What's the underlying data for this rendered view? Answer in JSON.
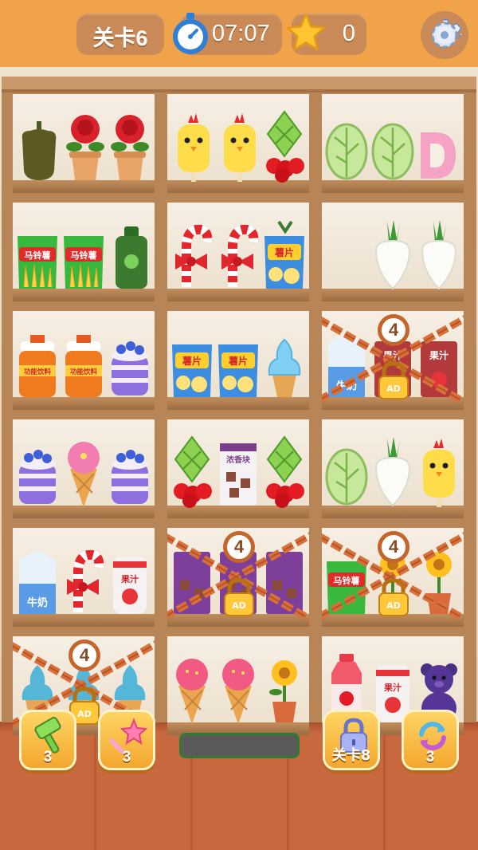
{
  "hud": {
    "level_label": "关卡6",
    "timer": "07:07",
    "stars": "0",
    "settings_icon": "gear-icon",
    "timer_icon": "stopwatch-icon",
    "star_icon": "star-icon"
  },
  "colors": {
    "top_bar": "#f0a349",
    "pill": "#c98a58",
    "shelf_wood": "#b88557",
    "lock_chain": "#d9703a",
    "tool_button": "#f7b93a"
  },
  "shelf": {
    "cells": [
      {
        "locked": false,
        "items": [
          "bell-pepper",
          "rose-pot",
          "rose-pot"
        ]
      },
      {
        "locked": false,
        "items": [
          "chick-popsicle",
          "chick-popsicle",
          "pineapple-cherry"
        ]
      },
      {
        "locked": false,
        "items": [
          "cabbage",
          "cabbage",
          "letter-d-donut"
        ]
      },
      {
        "locked": false,
        "items": [
          "potato-chips-bag",
          "potato-chips-bag",
          "apple-juice-bottle"
        ]
      },
      {
        "locked": false,
        "items": [
          "candy-cane-bow",
          "candy-cane-bow",
          "chips-bag"
        ]
      },
      {
        "locked": false,
        "items": [
          "",
          "radish",
          "radish"
        ]
      },
      {
        "locked": false,
        "items": [
          "sports-drink-jug",
          "sports-drink-jug",
          "blueberry-cake"
        ]
      },
      {
        "locked": false,
        "items": [
          "chips-bag",
          "chips-bag",
          "soft-serve-cone"
        ]
      },
      {
        "locked": true,
        "lock_count": "4",
        "items": [
          "milk-carton",
          "juice-carton",
          "juice-carton"
        ]
      },
      {
        "locked": false,
        "items": [
          "blueberry-cake",
          "ice-cream-cone",
          "blueberry-cake"
        ]
      },
      {
        "locked": false,
        "items": [
          "pineapple-cherry",
          "chocolate-carton",
          "pineapple-cherry"
        ]
      },
      {
        "locked": false,
        "items": [
          "cabbage",
          "radish",
          "chick-popsicle"
        ]
      },
      {
        "locked": false,
        "items": [
          "milk-carton",
          "candy-cane-bow",
          "juice-can"
        ]
      },
      {
        "locked": true,
        "lock_count": "4",
        "items": [
          "chocolate-carton",
          "chocolate-carton",
          "chocolate-carton"
        ]
      },
      {
        "locked": true,
        "lock_count": "4",
        "items": [
          "chips-bag",
          "sunflower-pot",
          "sunflower-pot"
        ]
      },
      {
        "locked": true,
        "lock_count": "4",
        "items": [
          "soft-serve-cone",
          "soft-serve-cone",
          "soft-serve-cone"
        ]
      },
      {
        "locked": false,
        "items": [
          "ice-cream-cone",
          "ice-cream-cone",
          "sunflower-pot"
        ]
      },
      {
        "locked": false,
        "items": [
          "strawberry-milk",
          "juice-can",
          "teddy-bear"
        ]
      }
    ],
    "text": {
      "potato_chips": "马铃薯",
      "chips": "薯片",
      "sports_drink": "功能饮料",
      "milk": "牛奶",
      "juice": "果汁",
      "chocolate": "浓香块",
      "ad": "AD"
    }
  },
  "toolbar": {
    "hammer": {
      "icon": "hammer-icon",
      "count": "3"
    },
    "magic_wand": {
      "icon": "magic-wand-icon",
      "count": "3"
    },
    "unlock": {
      "icon": "padlock-icon",
      "label": "关卡8"
    },
    "shuffle": {
      "icon": "shuffle-icon",
      "count": "3"
    }
  },
  "progress": {
    "fill": 0
  }
}
